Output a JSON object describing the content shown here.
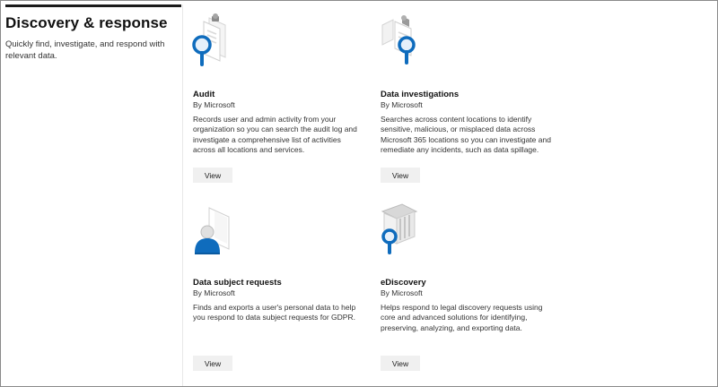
{
  "page": {
    "title": "Discovery & response",
    "description": "Quickly find, investigate, and respond with relevant data."
  },
  "cards": [
    {
      "title": "Audit",
      "publisher": "By Microsoft",
      "description": "Records user and admin activity from your organization so you can search the audit log and investigate a comprehensive list of activities across all locations and services.",
      "button_label": "View",
      "icon": "audit-document-magnifier-icon"
    },
    {
      "title": "Data investigations",
      "publisher": "By Microsoft",
      "description": "Searches across content locations to identify sensitive, malicious, or misplaced data across Microsoft 365 locations so you can investigate and remediate any incidents, such as data spillage.",
      "button_label": "View",
      "icon": "data-investigation-magnifier-icon"
    },
    {
      "title": "Data subject requests",
      "publisher": "By Microsoft",
      "description": "Finds and exports a user's personal data to help you respond to data subject requests for GDPR.",
      "button_label": "View",
      "icon": "person-document-icon"
    },
    {
      "title": "eDiscovery",
      "publisher": "By Microsoft",
      "description": "Helps respond to legal discovery requests using core and advanced solutions for identifying, preserving, analyzing, and exporting data.",
      "button_label": "View",
      "icon": "courthouse-magnifier-icon"
    }
  ],
  "colors": {
    "accent_blue": "#0f6cbd",
    "button_bg": "#f0f0f0"
  }
}
